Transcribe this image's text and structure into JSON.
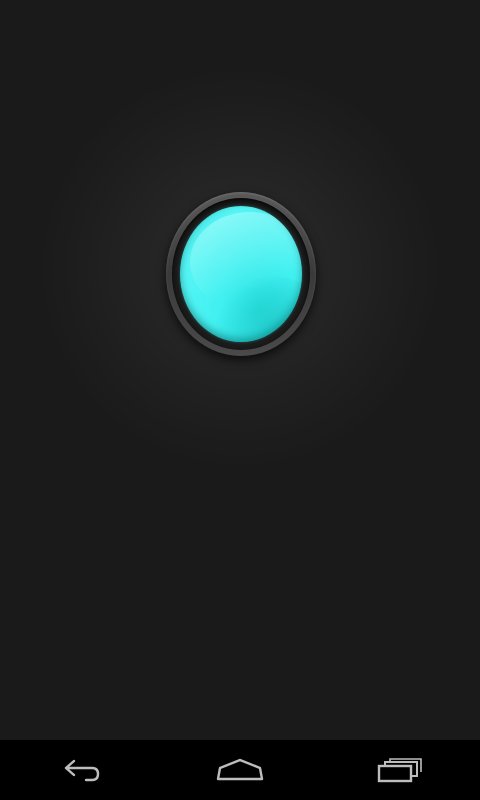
{
  "app": {
    "power_button": {
      "icon": "flashlight-lens-icon",
      "state": "on",
      "lens_color": "#40F0F0"
    }
  },
  "nav_bar": {
    "back": {
      "icon": "back-arrow-icon"
    },
    "home": {
      "icon": "home-icon"
    },
    "recents": {
      "icon": "recent-apps-icon"
    }
  },
  "colors": {
    "background": "#1A1A1A",
    "nav_background": "#000000",
    "nav_icon": "#BDBDBD",
    "bezel": "#4A4A4A"
  }
}
